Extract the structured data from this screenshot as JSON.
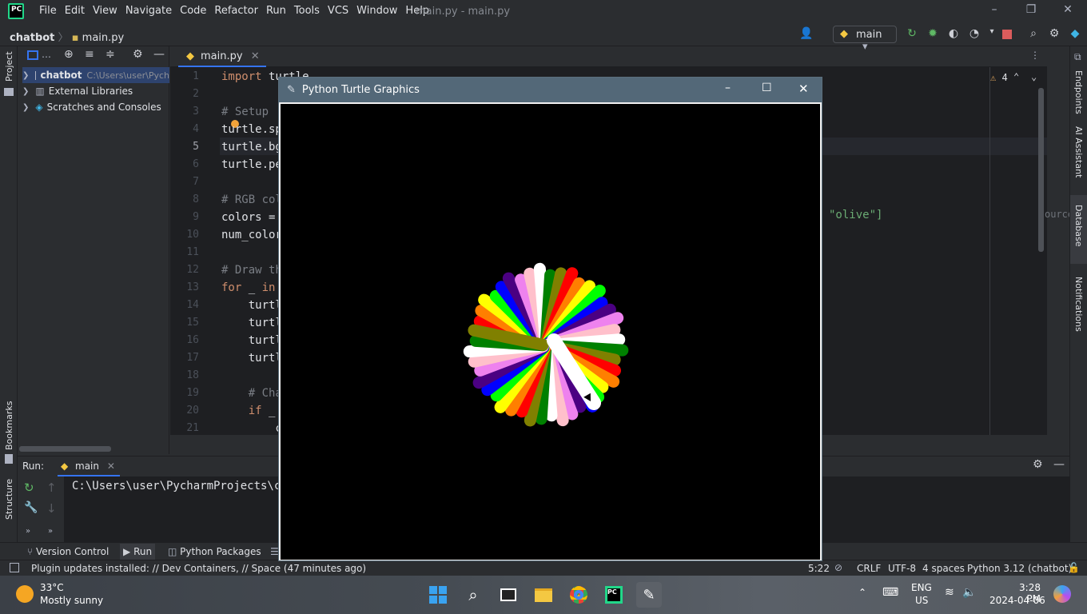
{
  "menu": [
    "File",
    "Edit",
    "View",
    "Navigate",
    "Code",
    "Refactor",
    "Run",
    "Tools",
    "VCS",
    "Window",
    "Help"
  ],
  "window_title": "main.py - main.py",
  "breadcrumb": {
    "project": "chatbot",
    "file": "main.py"
  },
  "run_config": "main",
  "project_panel": {
    "root_name": "chatbot",
    "root_path": "C:\\Users\\user\\Pych",
    "items": [
      "External Libraries",
      "Scratches and Consoles"
    ]
  },
  "left_stripe": {
    "project": "Project",
    "bookmarks": "Bookmarks",
    "structure": "Structure"
  },
  "right_stripe": [
    "Endpoints",
    "AI Assistant",
    "Database",
    "Notifications"
  ],
  "editor_tab": "main.py",
  "inspection_count": "4",
  "code_lines": [
    {
      "n": "1",
      "t": "import turtle"
    },
    {
      "n": "2",
      "t": ""
    },
    {
      "n": "3",
      "t": "# Setup"
    },
    {
      "n": "4",
      "t": "turtle.sp"
    },
    {
      "n": "5",
      "t": "turtle.bg"
    },
    {
      "n": "6",
      "t": "turtle.pe"
    },
    {
      "n": "7",
      "t": ""
    },
    {
      "n": "8",
      "t": "# RGB col"
    },
    {
      "n": "9",
      "t": "colors = "
    },
    {
      "n": "10",
      "t": "num_color"
    },
    {
      "n": "11",
      "t": ""
    },
    {
      "n": "12",
      "t": "# Draw th"
    },
    {
      "n": "13",
      "t": "for _ in "
    },
    {
      "n": "14",
      "t": "    turtl"
    },
    {
      "n": "15",
      "t": "    turtl"
    },
    {
      "n": "16",
      "t": "    turtl"
    },
    {
      "n": "17",
      "t": "    turtl"
    },
    {
      "n": "18",
      "t": ""
    },
    {
      "n": "19",
      "t": "    # Cha"
    },
    {
      "n": "20",
      "t": "    if _ "
    },
    {
      "n": "21",
      "t": "        c"
    }
  ],
  "code_right_fragment": "\"olive\"]",
  "code_right_extra": "ource",
  "run_panel": {
    "label": "Run:",
    "tab": "main",
    "console": "C:\\Users\\user\\PycharmProjects\\ch"
  },
  "bottom_tools": [
    "Version Control",
    "Run",
    "Python Packages"
  ],
  "status": {
    "message": "Plugin updates installed: // Dev Containers, // Space (47 minutes ago)",
    "position": "5:22",
    "line_sep": "CRLF",
    "encoding": "UTF-8",
    "indent": "4 spaces",
    "interpreter": "Python 3.12 (chatbot)"
  },
  "turtle_window": {
    "title": "Python Turtle Graphics"
  },
  "taskbar": {
    "weather_temp": "33°C",
    "weather_desc": "Mostly sunny",
    "lang": "ENG",
    "region": "US",
    "time": "3:28 PM",
    "date": "2024-04-06"
  },
  "colors": {
    "accent": "#3574f0",
    "spiral": [
      "#ff0000",
      "#ff7f00",
      "#ffff00",
      "#00ff00",
      "#0000ff",
      "#4b0082",
      "#ee82ee",
      "#ffc0cb",
      "#ffffff",
      "#008000",
      "#808000"
    ]
  }
}
